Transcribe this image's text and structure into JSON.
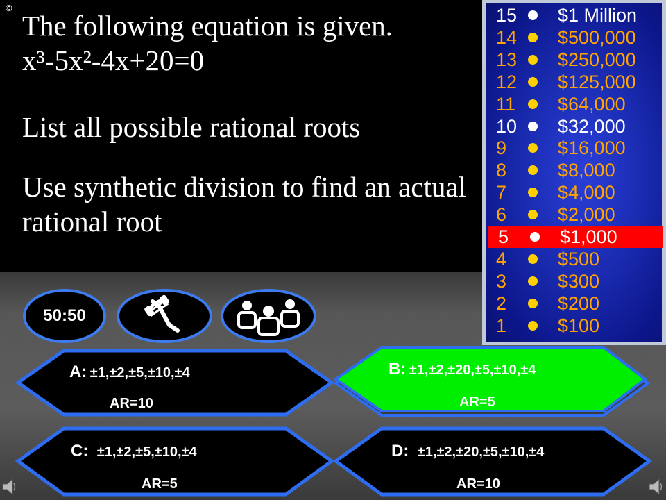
{
  "copyright": "©",
  "question": {
    "line1": "The following equation is given. x³-5x²-4x+20=0",
    "line2": "List all possible rational roots",
    "line3": "Use synthetic division to find an actual rational root"
  },
  "ladder": [
    {
      "num": "15",
      "amount": "$1 Million",
      "style": "white"
    },
    {
      "num": "14",
      "amount": "$500,000",
      "style": "gold"
    },
    {
      "num": "13",
      "amount": "$250,000",
      "style": "gold"
    },
    {
      "num": "12",
      "amount": "$125,000",
      "style": "gold"
    },
    {
      "num": "11",
      "amount": "$64,000",
      "style": "gold"
    },
    {
      "num": "10",
      "amount": "$32,000",
      "style": "white"
    },
    {
      "num": "9",
      "amount": "$16,000",
      "style": "gold"
    },
    {
      "num": "8",
      "amount": "$8,000",
      "style": "gold"
    },
    {
      "num": "7",
      "amount": "$4,000",
      "style": "gold"
    },
    {
      "num": "6",
      "amount": "$2,000",
      "style": "gold"
    },
    {
      "num": "5",
      "amount": "$1,000",
      "style": "current"
    },
    {
      "num": "4",
      "amount": "$500",
      "style": "gold"
    },
    {
      "num": "3",
      "amount": "$300",
      "style": "gold"
    },
    {
      "num": "2",
      "amount": "$200",
      "style": "gold"
    },
    {
      "num": "1",
      "amount": "$100",
      "style": "gold"
    }
  ],
  "lifelines": {
    "fifty_fifty": "50:50",
    "phone_icon": "phone-icon",
    "audience_icon": "audience-icon"
  },
  "answers": {
    "a": {
      "key": "A:",
      "text": "±1,±2,±5,±10,±4",
      "ar": "AR=10"
    },
    "b": {
      "key": "B:",
      "text": "±1,±2,±20,±5,±10,±4",
      "ar": "AR=5"
    },
    "c": {
      "key": "C:",
      "text": "±1,±2,±5,±10,±4",
      "ar": "AR=5"
    },
    "d": {
      "key": "D:",
      "text": "±1,±2,±20,±5,±10,±4",
      "ar": "AR=10"
    }
  },
  "colors": {
    "selected_answer": "#00ee00",
    "answer_fill": "#000000",
    "answer_border": "#2e6cf0",
    "ladder_gold": "#ffa400",
    "ladder_current": "#ff0000"
  }
}
